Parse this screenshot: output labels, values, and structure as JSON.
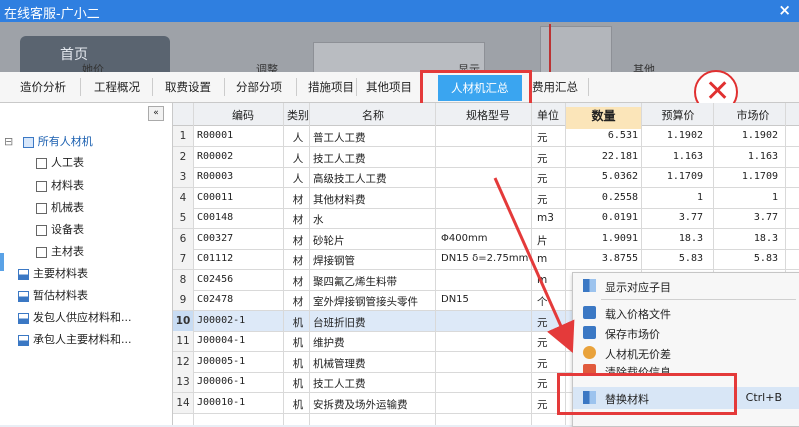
{
  "window": {
    "title": "在线客服-广小二",
    "close": "×"
  },
  "background": {
    "home_label": "首页",
    "labels": [
      "她价",
      "调整",
      "显示",
      "其他"
    ]
  },
  "tabs": [
    "造价分析",
    "工程概况",
    "取费设置",
    "分部分项",
    "措施项目",
    "其他项目",
    "人材机汇总",
    "费用汇总"
  ],
  "active_tab": "人材机汇总",
  "tree": {
    "collapse": "«",
    "items": [
      {
        "label": "所有人材机",
        "level": 0,
        "icon": "folder-icon",
        "toggle": "⊟"
      },
      {
        "label": "人工表",
        "level": 1,
        "icon": "doc-icon"
      },
      {
        "label": "材料表",
        "level": 1,
        "icon": "doc-icon"
      },
      {
        "label": "机械表",
        "level": 1,
        "icon": "doc-icon"
      },
      {
        "label": "设备表",
        "level": 1,
        "icon": "doc-icon"
      },
      {
        "label": "主材表",
        "level": 1,
        "icon": "doc-icon"
      },
      {
        "label": "主要材料表",
        "level": 0,
        "icon": "chart-icon"
      },
      {
        "label": "暂估材料表",
        "level": 0,
        "icon": "chart-icon"
      },
      {
        "label": "发包人供应材料和...",
        "level": 0,
        "icon": "chart-icon"
      },
      {
        "label": "承包人主要材料和...",
        "level": 0,
        "icon": "chart-icon"
      }
    ]
  },
  "table": {
    "columns": [
      "编码",
      "类别",
      "名称",
      "规格型号",
      "单位",
      "数量",
      "预算价",
      "市场价"
    ],
    "rows": [
      {
        "n": "1",
        "code": "R00001",
        "type": "人",
        "name": "普工人工费",
        "spec": "",
        "unit": "元",
        "qty": "6.531",
        "budget": "1.1902",
        "market": "1.1902"
      },
      {
        "n": "2",
        "code": "R00002",
        "type": "人",
        "name": "技工人工费",
        "spec": "",
        "unit": "元",
        "qty": "22.181",
        "budget": "1.163",
        "market": "1.163"
      },
      {
        "n": "3",
        "code": "R00003",
        "type": "人",
        "name": "高级技工人工费",
        "spec": "",
        "unit": "元",
        "qty": "5.0362",
        "budget": "1.1709",
        "market": "1.1709"
      },
      {
        "n": "4",
        "code": "C00011",
        "type": "材",
        "name": "其他材料费",
        "spec": "",
        "unit": "元",
        "qty": "0.2558",
        "budget": "1",
        "market": "1"
      },
      {
        "n": "5",
        "code": "C00148",
        "type": "材",
        "name": "水",
        "spec": "",
        "unit": "m3",
        "qty": "0.0191",
        "budget": "3.77",
        "market": "3.77"
      },
      {
        "n": "6",
        "code": "C00327",
        "type": "材",
        "name": "砂轮片",
        "spec": "Φ400mm",
        "unit": "片",
        "qty": "1.9091",
        "budget": "18.3",
        "market": "18.3"
      },
      {
        "n": "7",
        "code": "C01112",
        "type": "材",
        "name": "焊接钢管",
        "spec": "DN15 δ=2.75mm",
        "unit": "m",
        "qty": "3.8755",
        "budget": "5.83",
        "market": "5.83"
      },
      {
        "n": "8",
        "code": "C02456",
        "type": "材",
        "name": "聚四氟乙烯生料带",
        "spec": "",
        "unit": "m",
        "qty": "",
        "budget": "",
        "market": ""
      },
      {
        "n": "9",
        "code": "C02478",
        "type": "材",
        "name": "室外焊接钢管接头零件",
        "spec": "DN15",
        "unit": "个",
        "qty": "",
        "budget": "",
        "market": ""
      },
      {
        "n": "10",
        "code": "J00002-1",
        "type": "机",
        "name": "台班折旧费",
        "spec": "",
        "unit": "元",
        "qty": "",
        "budget": "",
        "market": ""
      },
      {
        "n": "11",
        "code": "J00004-1",
        "type": "机",
        "name": "维护费",
        "spec": "",
        "unit": "元",
        "qty": "",
        "budget": "",
        "market": ""
      },
      {
        "n": "12",
        "code": "J00005-1",
        "type": "机",
        "name": "机械管理费",
        "spec": "",
        "unit": "元",
        "qty": "",
        "budget": "",
        "market": ""
      },
      {
        "n": "13",
        "code": "J00006-1",
        "type": "机",
        "name": "技工人工费",
        "spec": "",
        "unit": "元",
        "qty": "",
        "budget": "",
        "market": ""
      },
      {
        "n": "14",
        "code": "J00010-1",
        "type": "机",
        "name": "安拆费及场外运输费",
        "spec": "",
        "unit": "元",
        "qty": "",
        "budget": "",
        "market": ""
      }
    ]
  },
  "context_menu": {
    "items": [
      {
        "label": "显示对应子目",
        "icon": "list-icon",
        "shortcut": ""
      },
      {
        "label": "载入价格文件",
        "icon": "load-icon",
        "shortcut": ""
      },
      {
        "label": "保存市场价",
        "icon": "save-icon",
        "shortcut": ""
      },
      {
        "label": "人材机无价差",
        "icon": "person-icon",
        "shortcut": ""
      },
      {
        "label": "清除载价信息",
        "icon": "clear-icon",
        "shortcut": ""
      },
      {
        "label": "替换材料",
        "icon": "replace-icon",
        "shortcut": "Ctrl+B"
      }
    ]
  },
  "colors": {
    "accent": "#3aa5f0",
    "highlight": "#e43a3a",
    "title_bar": "#2f7fe0"
  }
}
